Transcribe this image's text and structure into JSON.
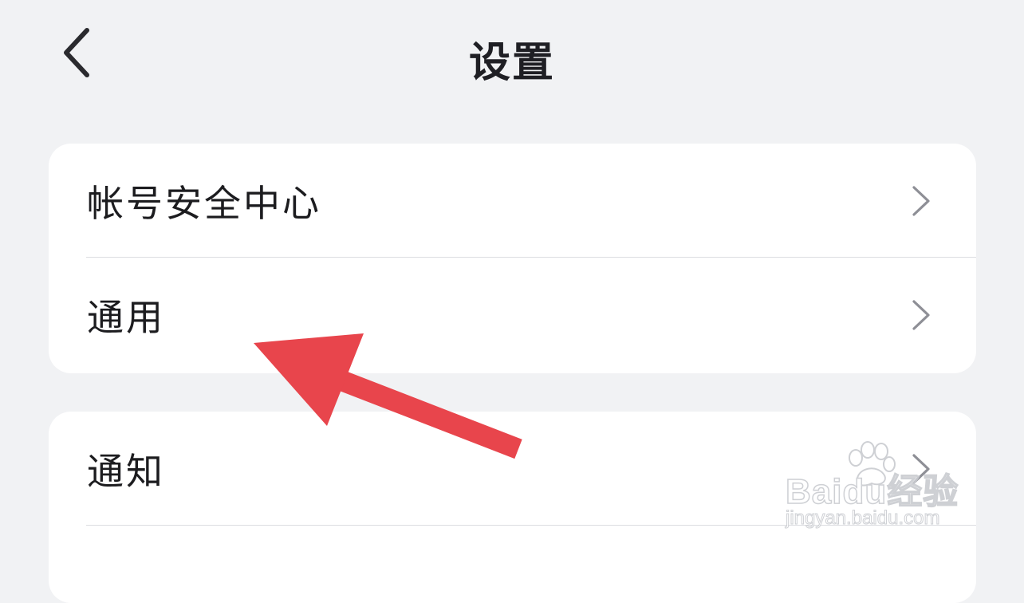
{
  "header": {
    "title": "设置",
    "back_icon": "chevron-left-icon"
  },
  "groups": [
    {
      "items": [
        {
          "label": "帐号安全中心",
          "icon": "chevron-right-icon"
        },
        {
          "label": "通用",
          "icon": "chevron-right-icon"
        }
      ]
    },
    {
      "items": [
        {
          "label": "通知",
          "icon": "chevron-right-icon"
        }
      ]
    }
  ],
  "annotation": {
    "color": "#e8454c",
    "icon": "red-arrow-annotation"
  },
  "watermark": {
    "brand": "Baidu经验",
    "url": "jingyan.baidu.com"
  },
  "colors": {
    "background": "#f1f2f4",
    "card": "#ffffff",
    "text": "#1c1c1f",
    "chevron": "#8e8f96"
  }
}
